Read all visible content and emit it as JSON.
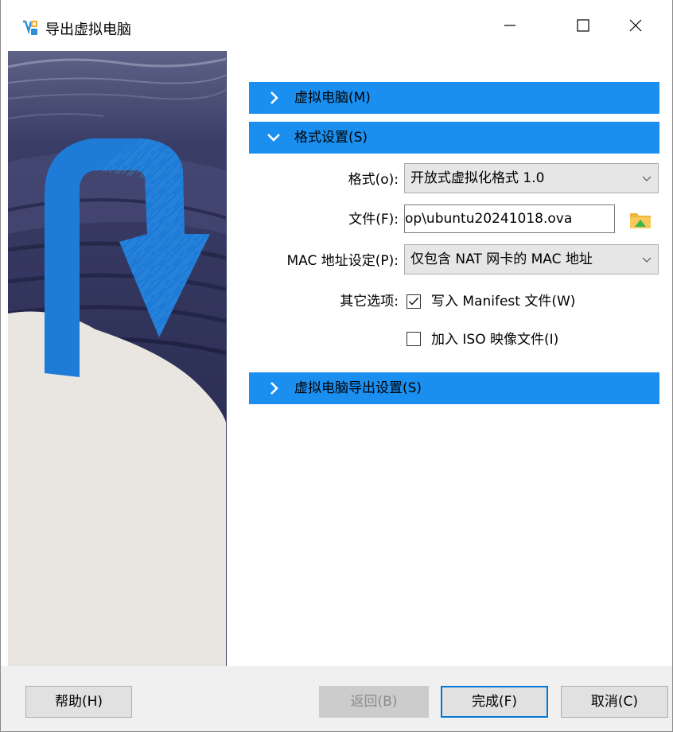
{
  "window": {
    "title": "导出虚拟电脑",
    "controls": {
      "minimize": "minimize-icon",
      "maximize": "maximize-icon",
      "close": "close-icon"
    }
  },
  "sections": [
    {
      "label": "虚拟电脑(M)",
      "expanded": false
    },
    {
      "label": "格式设置(S)",
      "expanded": true
    },
    {
      "label": "虚拟电脑导出设置(S)",
      "expanded": false
    }
  ],
  "format_settings": {
    "format": {
      "label": "格式(o):",
      "value": "开放式虚拟化格式 1.0"
    },
    "file": {
      "label": "文件(F):",
      "value": "op\\ubuntu20241018.ova"
    },
    "mac": {
      "label": "MAC 地址设定(P):",
      "value": "仅包含 NAT 网卡的 MAC 地址"
    },
    "other_options_label": "其它选项:",
    "options": [
      {
        "label": "写入 Manifest 文件(W)",
        "checked": true
      },
      {
        "label": "加入 ISO 映像文件(I)",
        "checked": false
      }
    ]
  },
  "buttons": {
    "help": "帮助(H)",
    "back": "返回(B)",
    "finish": "完成(F)",
    "cancel": "取消(C)"
  },
  "colors": {
    "section_header": "#1a8ff0",
    "graphic_dark": "#2b2d55",
    "graphic_arrow": "#1f7bd8",
    "graphic_light": "#e9e6e1"
  }
}
